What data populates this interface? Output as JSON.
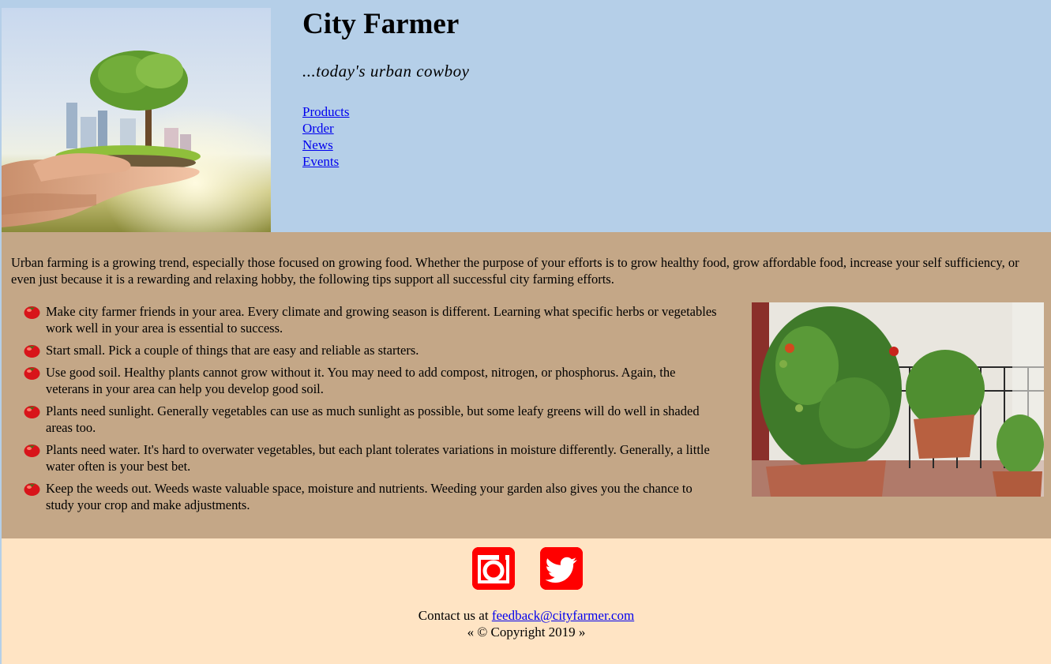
{
  "site": {
    "title": "City Farmer",
    "tagline": "...today's urban cowboy"
  },
  "nav": {
    "items": [
      {
        "label": "Products"
      },
      {
        "label": "Order"
      },
      {
        "label": "News"
      },
      {
        "label": "Events"
      }
    ]
  },
  "main": {
    "intro": "Urban farming is a growing trend, especially those focused on growing food. Whether the purpose of your efforts is to grow healthy food, grow affordable food, increase your self sufficiency, or even just because it is a rewarding and relaxing hobby, the following tips support all successful city farming efforts.",
    "tips": [
      "Make city farmer friends in your area. Every climate and growing season is different. Learning what specific herbs or vegetables work well in your area is essential to success.",
      "Start small. Pick a couple of things that are easy and reliable as starters.",
      "Use good soil. Healthy plants cannot grow without it. You may need to add compost, nitrogen, or phosphorus. Again, the veterans in your area can help you develop good soil.",
      "Plants need sunlight. Generally vegetables can use as much sunlight as possible, but some leafy greens will do well in shaded areas too.",
      "Plants need water. It's hard to overwater vegetables, but each plant tolerates variations in moisture differently. Generally, a little water often is your best bet.",
      "Keep the weeds out. Weeds waste valuable space, moisture and nutrients. Weeding your garden also gives you the chance to study your crop and make adjustments."
    ],
    "bullet_icon": "tomato-icon"
  },
  "footer": {
    "social": [
      {
        "icon": "instagram-icon"
      },
      {
        "icon": "twitter-icon"
      }
    ],
    "contact_prefix": "Contact us at ",
    "contact_email": "feedback@cityfarmer.com",
    "copyright": "« © Copyright 2019 »"
  },
  "colors": {
    "header_bg": "#b5cfe8",
    "main_bg": "#c4a787",
    "footer_bg": "#ffe4c4",
    "social_red": "#ff0000",
    "link": "#0000ee"
  }
}
